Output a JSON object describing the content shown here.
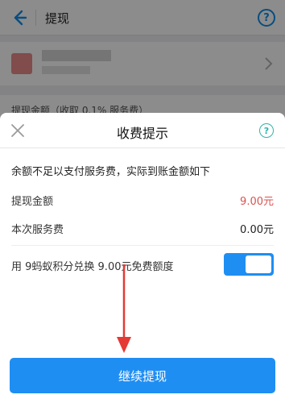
{
  "header": {
    "title": "提现",
    "help_icon_glyph": "?"
  },
  "withdraw_amount_label": "提现金额（收取 0.1% 服务费）",
  "fee_dialog": {
    "title": "收费提示",
    "help_icon_glyph": "?",
    "notice": "余额不足以支付服务费，实际到账金额如下",
    "rows": [
      {
        "label": "提现金额",
        "value": "9.00元",
        "value_color": "#d9534f"
      },
      {
        "label": "本次服务费",
        "value": "0.00元",
        "value_color": "#222222"
      }
    ],
    "points_toggle": {
      "label": "用 9蚂蚁积分兑换 9.00元免费额度",
      "on": true
    },
    "continue_label": "继续提现"
  },
  "colors": {
    "accent": "#1f8ef3",
    "red_value": "#d9534f"
  }
}
